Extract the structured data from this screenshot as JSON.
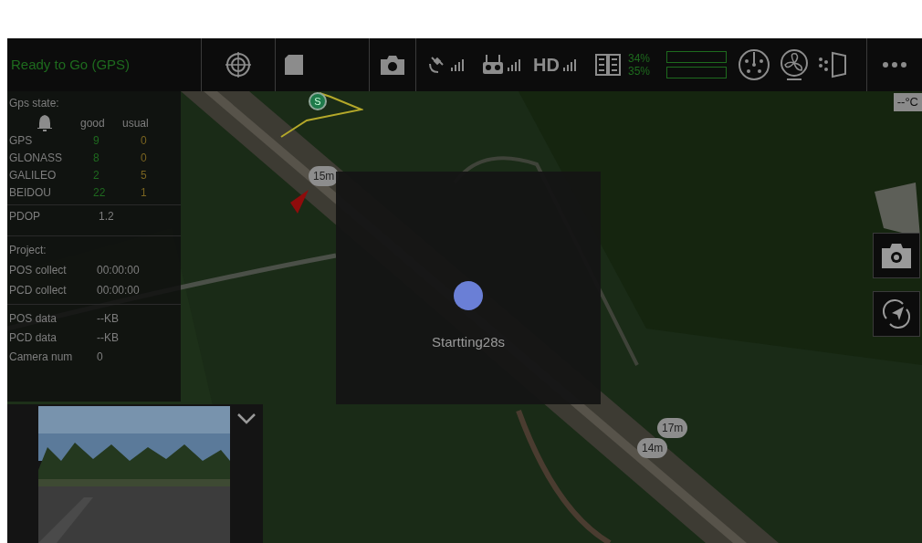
{
  "status_bar": {
    "flight_status": "Ready to Go (GPS)",
    "hd_label": "HD",
    "battery": [
      {
        "percent": "34%"
      },
      {
        "percent": "35%"
      }
    ]
  },
  "temperature": "--°C",
  "gps_panel": {
    "title": "Gps state:",
    "columns": [
      "good",
      "usual"
    ],
    "rows": [
      {
        "name": "GPS",
        "good": "9",
        "usual": "0"
      },
      {
        "name": "GLONASS",
        "good": "8",
        "usual": "0"
      },
      {
        "name": "GALILEO",
        "good": "2",
        "usual": "5"
      },
      {
        "name": "BEIDOU",
        "good": "22",
        "usual": "1"
      }
    ],
    "pdop": {
      "label": "PDOP",
      "value": "1.2"
    }
  },
  "project": {
    "title": "Project:",
    "rows": [
      {
        "label": "POS collect",
        "value": "00:00:00"
      },
      {
        "label": "PCD collect",
        "value": "00:00:00"
      }
    ]
  },
  "data": {
    "rows": [
      {
        "label": "POS data",
        "value": "--KB"
      },
      {
        "label": "PCD data",
        "value": "--KB"
      },
      {
        "label": "Camera num",
        "value": "0"
      }
    ]
  },
  "map_markers": [
    {
      "label": "S"
    },
    {
      "label": "15m"
    },
    {
      "label": "17m"
    },
    {
      "label": "14m"
    }
  ],
  "starting": {
    "message": "Startting28s"
  }
}
